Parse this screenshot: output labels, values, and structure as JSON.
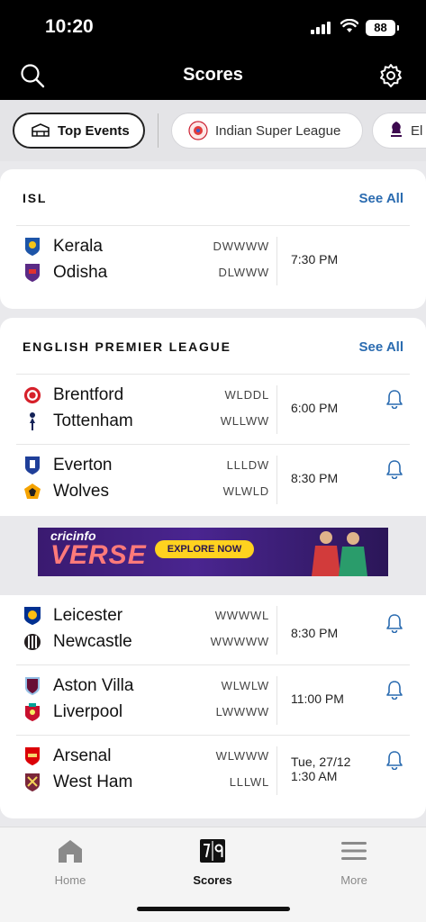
{
  "status": {
    "time": "10:20",
    "battery": "88"
  },
  "header": {
    "title": "Scores"
  },
  "chips": [
    {
      "label": "Top Events",
      "active": true
    },
    {
      "label": "Indian Super League"
    },
    {
      "label": "El"
    }
  ],
  "isl": {
    "title": "ISL",
    "see_all": "See All",
    "matches": [
      {
        "home": "Kerala",
        "home_form": "DWWWW",
        "away": "Odisha",
        "away_form": "DLWWW",
        "time": "7:30 PM"
      }
    ]
  },
  "epl": {
    "title": "ENGLISH PREMIER LEAGUE",
    "see_all": "See All",
    "matches": [
      {
        "home": "Brentford",
        "home_form": "WLDDL",
        "away": "Tottenham",
        "away_form": "WLLWW",
        "time": "6:00 PM"
      },
      {
        "home": "Everton",
        "home_form": "LLLDW",
        "away": "Wolves",
        "away_form": "WLWLD",
        "time": "8:30 PM"
      },
      {
        "home": "Leicester",
        "home_form": "WWWWL",
        "away": "Newcastle",
        "away_form": "WWWWW",
        "time": "8:30 PM"
      },
      {
        "home": "Aston Villa",
        "home_form": "WLWLW",
        "away": "Liverpool",
        "away_form": "LWWWW",
        "time": "11:00 PM"
      },
      {
        "home": "Arsenal",
        "home_form": "WLWWW",
        "away": "West Ham",
        "away_form": "LLLWL",
        "time_line1": "Tue, 27/12",
        "time_line2": "1:30 AM"
      }
    ]
  },
  "ad": {
    "brand_top": "cricinfo",
    "brand_main": "VERSE",
    "cta": "EXPLORE NOW"
  },
  "nav": {
    "home": "Home",
    "scores": "Scores",
    "more": "More"
  },
  "colors": {
    "accent": "#2a6bb0",
    "bar": "#000000",
    "ad_bg": "#3a1a70"
  }
}
